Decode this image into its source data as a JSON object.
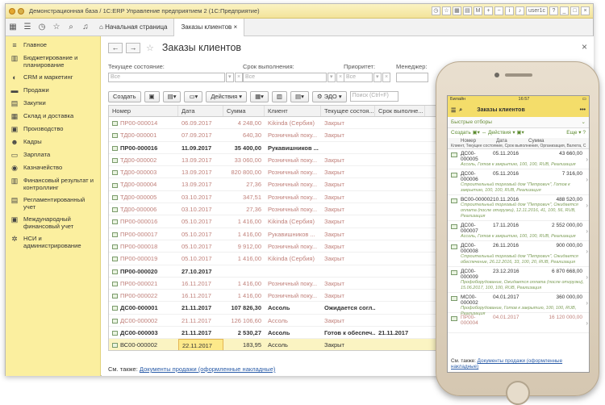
{
  "window": {
    "title": "Демонстрационная база / 1С:ERP Управление предприятием 2  (1С:Предприятие)",
    "user": "user1c"
  },
  "tabs": [
    {
      "label": "Начальная страница"
    },
    {
      "label": "Заказы клиентов"
    }
  ],
  "sidebar": {
    "items": [
      {
        "label": "Главное",
        "icon": "list-icon"
      },
      {
        "label": "Бюджетирование и планирование",
        "icon": "budget-icon"
      },
      {
        "label": "CRM и маркетинг",
        "icon": "crm-icon"
      },
      {
        "label": "Продажи",
        "icon": "sales-icon"
      },
      {
        "label": "Закупки",
        "icon": "purchases-icon"
      },
      {
        "label": "Склад и доставка",
        "icon": "warehouse-icon"
      },
      {
        "label": "Производство",
        "icon": "production-icon"
      },
      {
        "label": "Кадры",
        "icon": "staff-icon"
      },
      {
        "label": "Зарплата",
        "icon": "salary-icon"
      },
      {
        "label": "Казначейство",
        "icon": "treasury-icon"
      },
      {
        "label": "Финансовый результат и контроллинг",
        "icon": "finance-icon"
      },
      {
        "label": "Регламентированный учет",
        "icon": "accounting-icon"
      },
      {
        "label": "Международный финансовый учет",
        "icon": "intl-accounting-icon"
      },
      {
        "label": "НСИ и администрирование",
        "icon": "gear-icon"
      }
    ]
  },
  "form": {
    "title": "Заказы клиентов",
    "filters": {
      "state_label": "Текущее состояние:",
      "state_placeholder": "Все",
      "due_label": "Срок выполнения:",
      "due_placeholder": "Все",
      "priority_label": "Приоритет:",
      "priority_placeholder": "Все",
      "manager_label": "Менеджер:"
    },
    "toolbar": {
      "create": "Создать",
      "actions": "Действия",
      "edo": "ЭДО",
      "search_placeholder": "Поиск (Ctrl+F)"
    },
    "columns": [
      "Номер",
      "Дата",
      "Сумма",
      "Клиент",
      "Текущее состоя...",
      "Срок выполне..."
    ],
    "rows": [
      {
        "num": "ПР00-000014",
        "date": "06.09.2017",
        "sum": "4 248,00",
        "client": "Kikinda (Сербия)",
        "state": "Закрыт",
        "due": "",
        "style": "draft"
      },
      {
        "num": "ТД00-000001",
        "date": "07.09.2017",
        "sum": "640,30",
        "client": "Розничный поку...",
        "state": "Закрыт",
        "due": "",
        "style": "draft"
      },
      {
        "num": "ПР00-000016",
        "date": "11.09.2017",
        "sum": "35 400,00",
        "client": "Рукавишников ...",
        "state": "",
        "due": "",
        "style": "bold"
      },
      {
        "num": "ТД00-000002",
        "date": "13.09.2017",
        "sum": "33 060,00",
        "client": "Розничный поку...",
        "state": "Закрыт",
        "due": "",
        "style": "draft"
      },
      {
        "num": "ТД00-000003",
        "date": "13.09.2017",
        "sum": "820 800,00",
        "client": "Розничный поку...",
        "state": "Закрыт",
        "due": "",
        "style": "draft"
      },
      {
        "num": "ТД00-000004",
        "date": "13.09.2017",
        "sum": "27,36",
        "client": "Розничный поку...",
        "state": "Закрыт",
        "due": "",
        "style": "draft"
      },
      {
        "num": "ТД00-000005",
        "date": "03.10.2017",
        "sum": "347,51",
        "client": "Розничный поку...",
        "state": "Закрыт",
        "due": "",
        "style": "draft"
      },
      {
        "num": "ТД00-000006",
        "date": "03.10.2017",
        "sum": "27,36",
        "client": "Розничный поку...",
        "state": "Закрыт",
        "due": "",
        "style": "draft"
      },
      {
        "num": "ПР00-000016",
        "date": "05.10.2017",
        "sum": "1 416,00",
        "client": "Kikinda (Сербия)",
        "state": "Закрыт",
        "due": "",
        "style": "draft"
      },
      {
        "num": "ПР00-000017",
        "date": "05.10.2017",
        "sum": "1 416,00",
        "client": "Рукавишников ...",
        "state": "Закрыт",
        "due": "",
        "style": "draft"
      },
      {
        "num": "ПР00-000018",
        "date": "05.10.2017",
        "sum": "9 912,00",
        "client": "Розничный поку...",
        "state": "Закрыт",
        "due": "",
        "style": "draft"
      },
      {
        "num": "ПР00-000019",
        "date": "05.10.2017",
        "sum": "1 416,00",
        "client": "Kikinda (Сербия)",
        "state": "Закрыт",
        "due": "",
        "style": "draft"
      },
      {
        "num": "ПР00-000020",
        "date": "27.10.2017",
        "sum": "",
        "client": "",
        "state": "",
        "due": "",
        "style": "bold"
      },
      {
        "num": "ПР00-000021",
        "date": "16.11.2017",
        "sum": "1 416,00",
        "client": "Розничный поку...",
        "state": "Закрыт",
        "due": "",
        "style": "draft"
      },
      {
        "num": "ПР00-000022",
        "date": "16.11.2017",
        "sum": "1 416,00",
        "client": "Розничный поку...",
        "state": "Закрыт",
        "due": "",
        "style": "draft"
      },
      {
        "num": "ДС00-000001",
        "date": "21.11.2017",
        "sum": "107 826,30",
        "client": "Ассоль",
        "state": "Ожидается согл...",
        "due": "",
        "style": "bold"
      },
      {
        "num": "ДС00-000002",
        "date": "21.11.2017",
        "sum": "126 106,60",
        "client": "Ассоль",
        "state": "Закрыт",
        "due": "",
        "style": "draft"
      },
      {
        "num": "ДС00-000003",
        "date": "21.11.2017",
        "sum": "2 530,27",
        "client": "Ассоль",
        "state": "Готов к обеспеч...",
        "due": "21.11.2017",
        "style": "bold"
      },
      {
        "num": "ВС00-000002",
        "date": "22.11.2017",
        "sum": "183,95",
        "client": "Ассоль",
        "state": "Закрыт",
        "due": "",
        "style": "sel"
      }
    ],
    "see_also_prefix": "См. также:",
    "see_also_link": "Документы продажи (оформленные накладные)"
  },
  "mobile": {
    "status_left": "Билайн",
    "time": "16:57",
    "title": "Заказы клиентов",
    "quick_filters": "Быстрые отборы",
    "create": "Создать",
    "actions": "Действия",
    "more": "Еще",
    "cols": [
      "Номер",
      "Дата",
      "Сумма"
    ],
    "cols_sub": "Клиент, Текущее состояние, Срок выполнения, Организация, Валюта, Соглашение, Основание (ЗС 1...",
    "rows": [
      {
        "num": "ДС00-000005",
        "date": "05.11.2016",
        "sum": "43 660,00",
        "info": "Ассоль, Готов к закрытию, 100, 100, RUB, Реализация",
        "tall": false,
        "draft": false
      },
      {
        "num": "ДС00-000006",
        "date": "05.11.2016",
        "sum": "7 316,00",
        "info": "Строительный торговый дом \"Петрович\", Готов к закрытию, 100, 100, RUB, Реализация",
        "tall": true,
        "draft": false
      },
      {
        "num": "ВС00-000002",
        "date": "10.11.2016",
        "sum": "488 520,00",
        "info": "Строительный торговый дом \"Петрович\", Ожидается оплата (после отгрузки), 12.11.2016, 41, 100, 56, RUB, Реализация",
        "tall": true,
        "draft": false
      },
      {
        "num": "ДС00-000007",
        "date": "17.11.2016",
        "sum": "2 552 000,00",
        "info": "Ассоль, Готов к закрытию, 100, 100, RUB, Реализация",
        "tall": false,
        "draft": false
      },
      {
        "num": "ДС00-000008",
        "date": "26.11.2016",
        "sum": "900 000,00",
        "info": "Строительный торговый дом \"Петрович\", Ожидается обеспечение, 26.12.2016, 33, 100, 20, RUB, Реализация",
        "tall": true,
        "draft": false
      },
      {
        "num": "ДС00-000009",
        "date": "23.12.2016",
        "sum": "6 870 668,00",
        "info": "Профоборудование, Ожидается оплата (после отгрузки), 15.06.2017, 100, 100, RUB, Реализация",
        "tall": true,
        "draft": false
      },
      {
        "num": "МС00-000002",
        "date": "04.01.2017",
        "sum": "360 000,00",
        "info": "Профоборудование, Готов к закрытию, 100, 100, RUB, Реализация",
        "tall": false,
        "draft": false
      },
      {
        "num": "ПР00-000004",
        "date": "04.01.2017",
        "sum": "16 120 000,00",
        "info": "",
        "tall": false,
        "draft": true
      }
    ],
    "see_also_prefix": "См. также:",
    "see_also_link": "Документы продажи (оформленные накладные)"
  }
}
